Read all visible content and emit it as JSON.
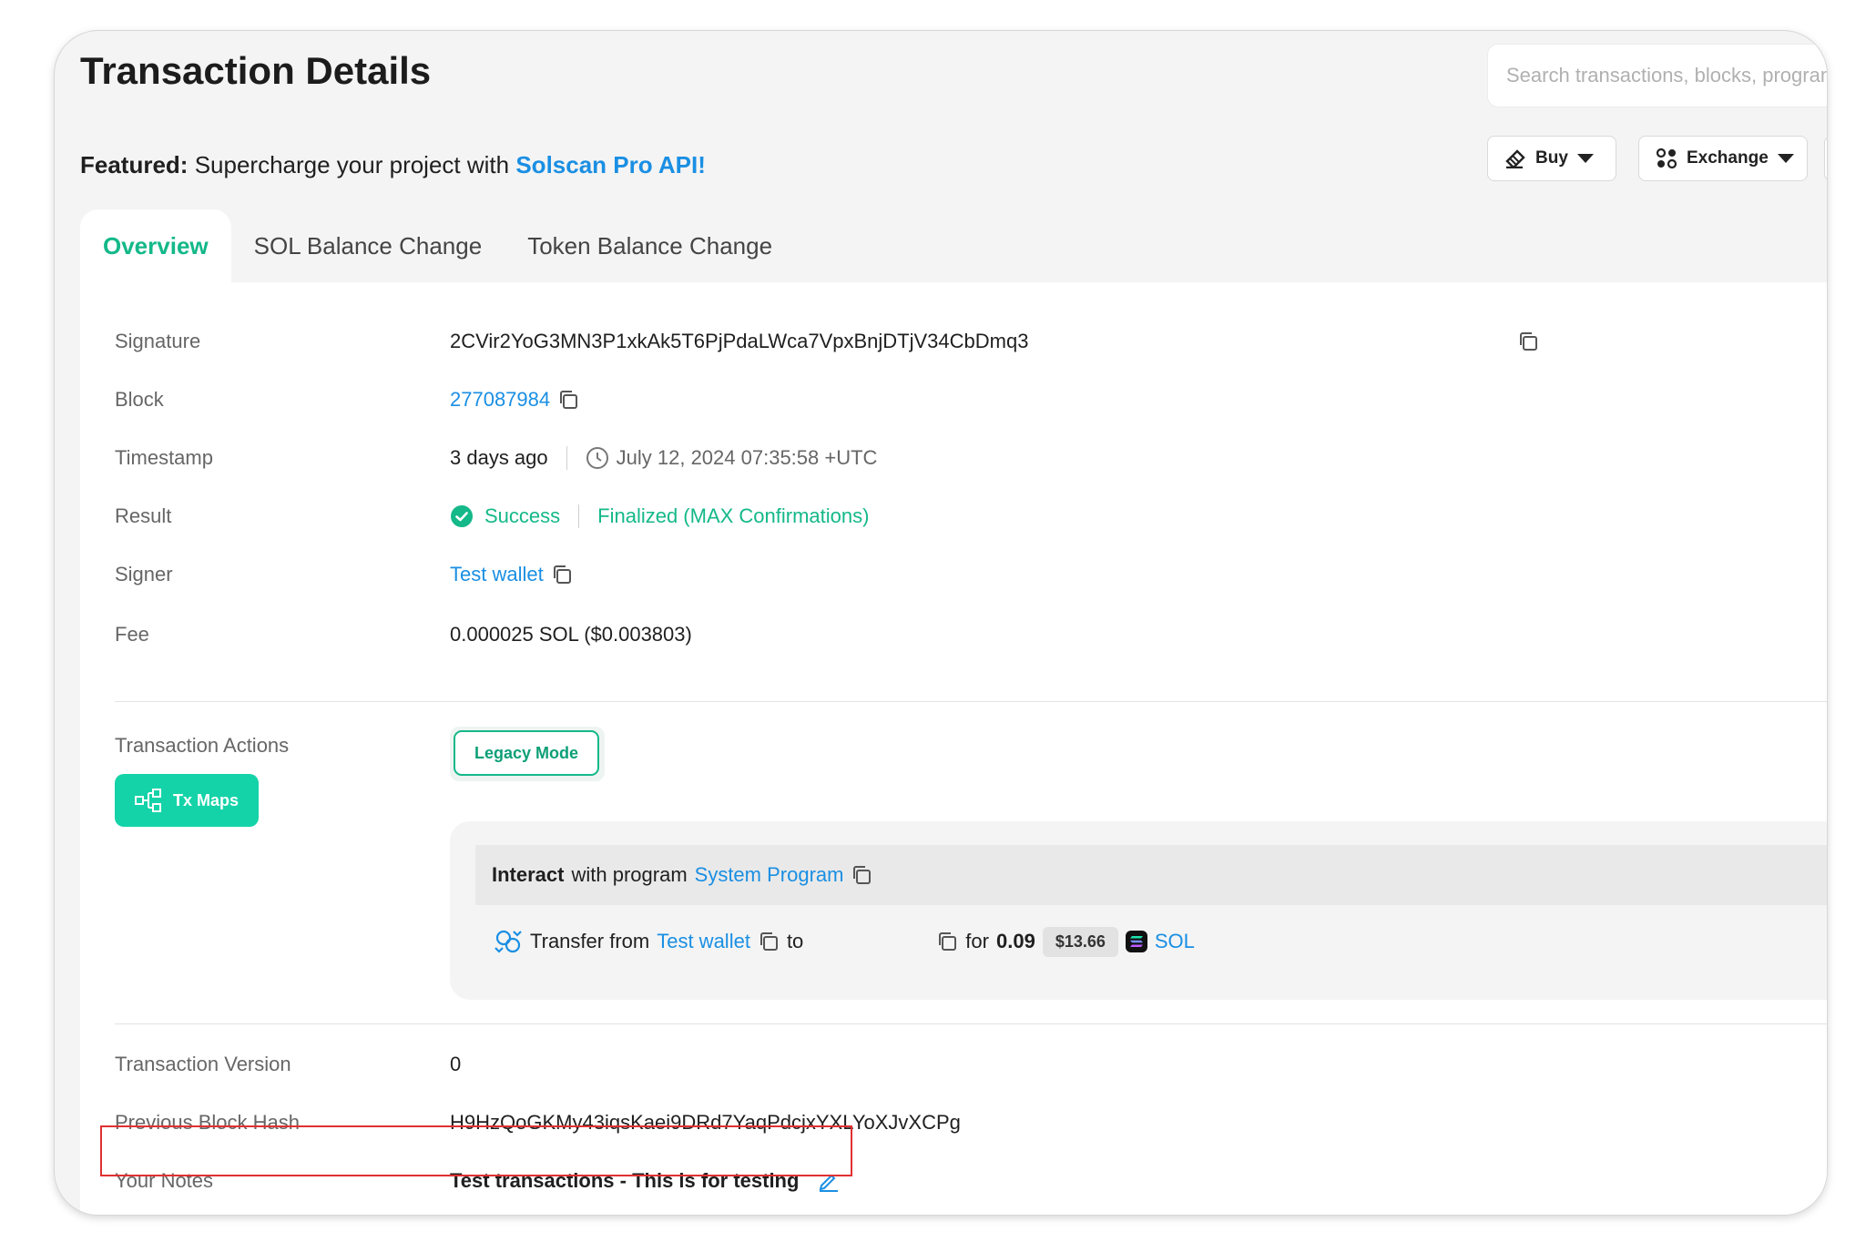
{
  "header": {
    "title": "Transaction Details",
    "search_placeholder": "Search transactions, blocks, programs and tokens",
    "buy_label": "Buy",
    "exchange_label": "Exchange"
  },
  "featured": {
    "prefix": "Featured:",
    "text": "Supercharge your project with",
    "link": "Solscan Pro API!"
  },
  "tabs": [
    {
      "label": "Overview",
      "active": true
    },
    {
      "label": "SOL Balance Change",
      "active": false
    },
    {
      "label": "Token Balance Change",
      "active": false
    }
  ],
  "details": {
    "signature": {
      "label": "Signature",
      "value": "2CVir2YoG3MN3P1xkAk5T6PjPdaLWca7VpxBnjDTjV34CbDmq3"
    },
    "block": {
      "label": "Block",
      "value": "277087984"
    },
    "timestamp": {
      "label": "Timestamp",
      "relative": "3 days ago",
      "absolute": "July 12, 2024 07:35:58 +UTC"
    },
    "result": {
      "label": "Result",
      "status": "Success",
      "finality": "Finalized (MAX Confirmations)"
    },
    "signer": {
      "label": "Signer",
      "value": "Test wallet"
    },
    "fee": {
      "label": "Fee",
      "value": "0.000025 SOL ($0.003803)"
    }
  },
  "actions": {
    "label": "Transaction Actions",
    "legacy_mode": "Legacy Mode",
    "tx_maps": "Tx Maps",
    "interact_bold": "Interact",
    "interact_text": "with program",
    "program": "System Program",
    "transfer_text": "Transfer from",
    "from": "Test wallet",
    "to_text": "to",
    "for_text": "for",
    "amount": "0.09",
    "usd": "$13.66",
    "token": "SOL"
  },
  "meta": {
    "version": {
      "label": "Transaction Version",
      "value": "0"
    },
    "prev_hash": {
      "label": "Previous Block Hash",
      "value": "H9HzQoGKMy43iqsKaei9DRd7YaqPdcjxYXLYoXJvXCPg"
    },
    "notes": {
      "label": "Your Notes",
      "value": "Test transactions - This is for testing"
    }
  },
  "colors": {
    "accent_green": "#14b889",
    "link_blue": "#1a8fe3",
    "highlight_red": "#e03131"
  }
}
